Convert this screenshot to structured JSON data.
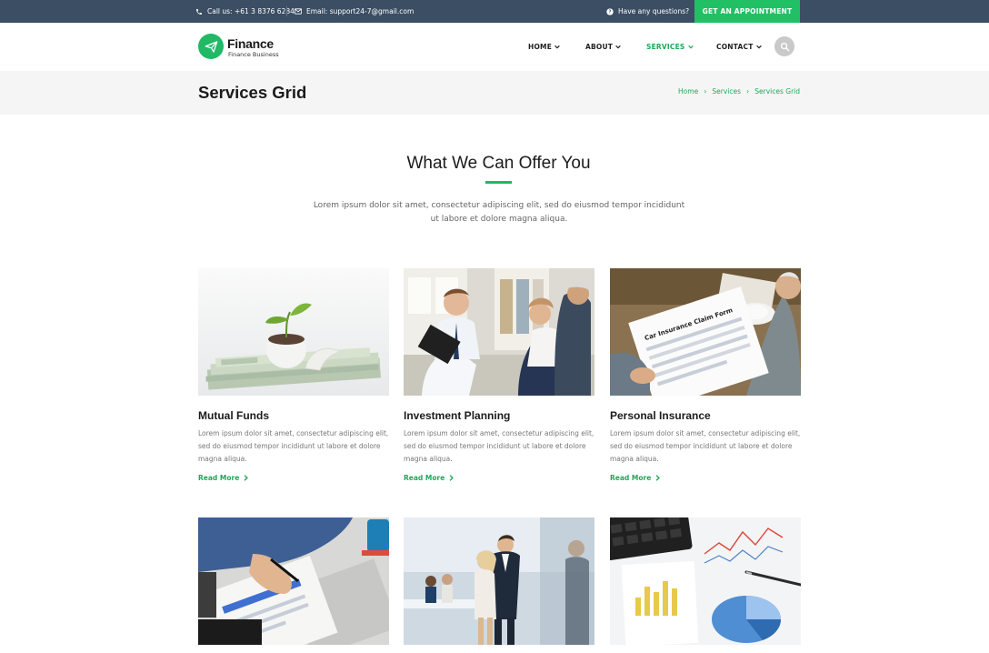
{
  "topbar": {
    "phone": "Call us: +61 3 8376 6284",
    "email": "Email: support24-7@gmail.com",
    "question": "Have any questions?",
    "cta": "GET AN APPOINTMENT"
  },
  "brand": {
    "name": "Finance",
    "tagline": "Finance Business",
    "accent": "#21b866"
  },
  "nav": {
    "items": [
      {
        "label": "HOME",
        "active": false
      },
      {
        "label": "ABOUT",
        "active": false
      },
      {
        "label": "SERVICES",
        "active": true
      },
      {
        "label": "CONTACT",
        "active": false
      }
    ]
  },
  "page": {
    "title": "Services Grid",
    "breadcrumb": [
      "Home",
      "Services",
      "Services Grid"
    ]
  },
  "section": {
    "title": "What We Can Offer You",
    "desc": "Lorem ipsum dolor sit amet, consectetur adipiscing elit, sed do eiusmod tempor incididunt ut labore et dolore magna aliqua."
  },
  "services": [
    {
      "title": "Mutual Funds",
      "text": "Lorem ipsum dolor sit amet, consectetur adipiscing elit, sed do eiusmod tempor incididunt ut labore et dolore magna aliqua.",
      "link": "Read More"
    },
    {
      "title": "Investment Planning",
      "text": "Lorem ipsum dolor sit amet, consectetur adipiscing elit, sed do eiusmod tempor incididunt ut labore et dolore magna aliqua.",
      "link": "Read More"
    },
    {
      "title": "Personal Insurance",
      "text": "Lorem ipsum dolor sit amet, consectetur adipiscing elit, sed do eiusmod tempor incididunt ut labore et dolore magna aliqua.",
      "link": "Read More"
    }
  ],
  "images": {
    "insurance_form_title": "Car Insurance Claim Form"
  },
  "colors": {
    "topbar": "#3c4e63",
    "accent": "#21c064",
    "titlebar": "#f5f5f5"
  }
}
